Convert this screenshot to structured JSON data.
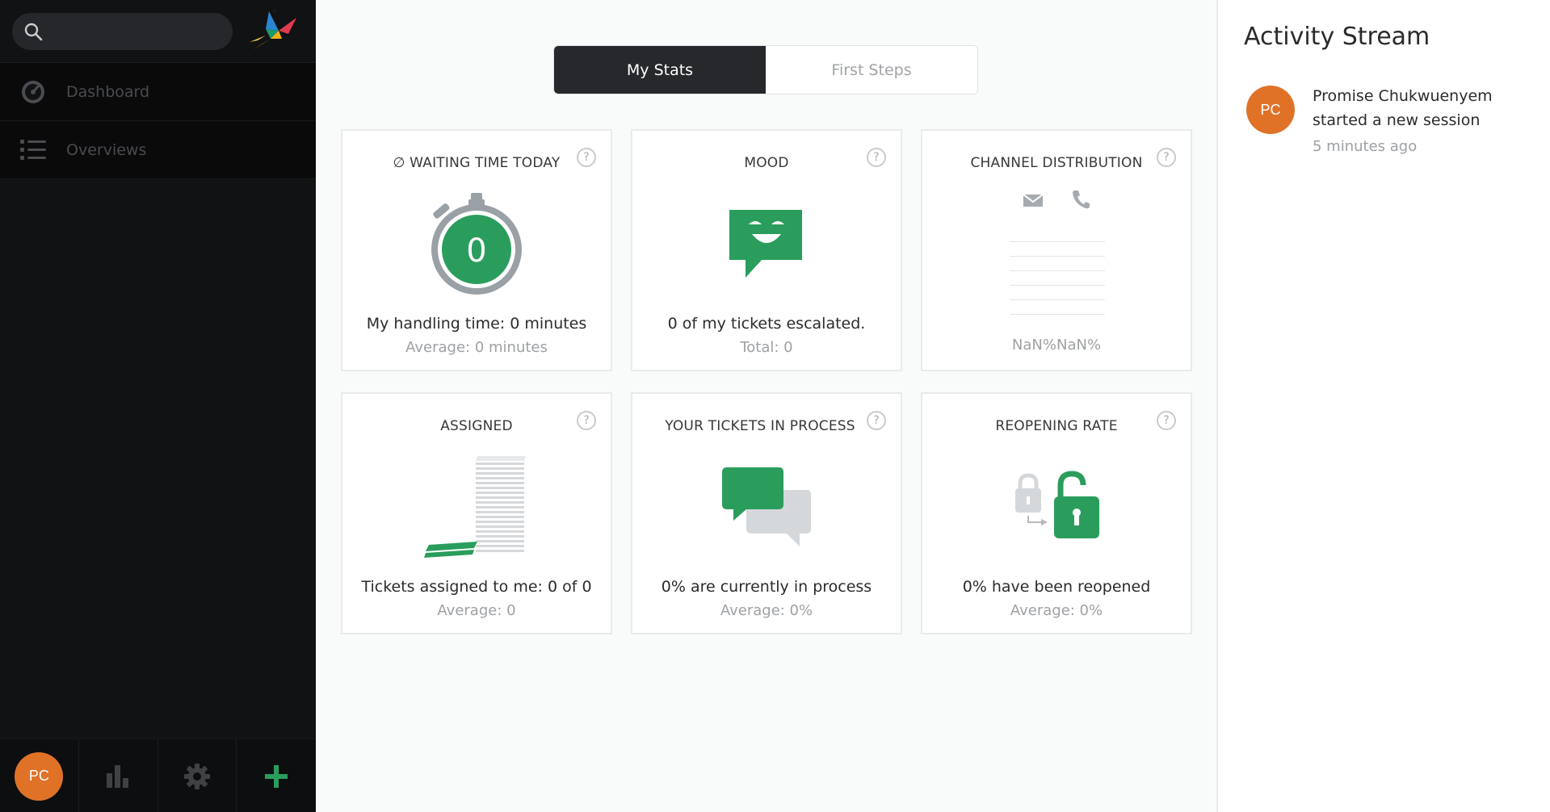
{
  "sidebar": {
    "search": {
      "placeholder": ""
    },
    "nav": [
      {
        "label": "Dashboard",
        "icon": "dashboard-icon"
      },
      {
        "label": "Overviews",
        "icon": "list-icon"
      }
    ],
    "bottom": {
      "avatar_initials": "PC",
      "icons": [
        "bar-chart-icon",
        "gear-icon",
        "plus-icon"
      ]
    }
  },
  "tabs": [
    {
      "label": "My Stats",
      "active": true
    },
    {
      "label": "First Steps",
      "active": false
    }
  ],
  "cards": {
    "waiting_time": {
      "title": "∅ WAITING TIME TODAY",
      "value": "0",
      "main": "My handling time: 0 minutes",
      "sub": "Average: 0 minutes"
    },
    "mood": {
      "title": "MOOD",
      "main": "0 of my tickets escalated.",
      "sub": "Total: 0"
    },
    "channel": {
      "title": "CHANNEL DISTRIBUTION",
      "footer": "NaN%NaN%",
      "icons": [
        "email-icon",
        "phone-icon"
      ]
    },
    "assigned": {
      "title": "ASSIGNED",
      "main": "Tickets assigned to me: 0 of 0",
      "sub": "Average: 0"
    },
    "in_process": {
      "title": "YOUR TICKETS IN PROCESS",
      "main": "0% are currently in process",
      "sub": "Average: 0%"
    },
    "reopening": {
      "title": "REOPENING RATE",
      "main": "0% have been reopened",
      "sub": "Average: 0%"
    }
  },
  "help_glyph": "?",
  "activity": {
    "title": "Activity Stream",
    "items": [
      {
        "initials": "PC",
        "name": "Promise Chukwuenyem",
        "text": "started a new session",
        "time": "5 minutes ago"
      }
    ]
  },
  "colors": {
    "accent": "#2a9d5c",
    "avatar": "#e07228",
    "sidebar": "#111214"
  }
}
